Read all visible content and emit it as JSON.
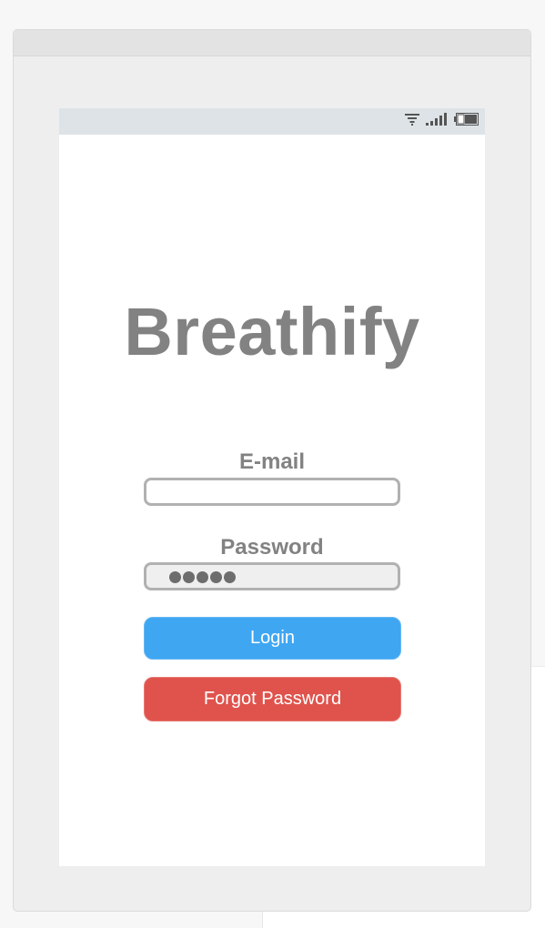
{
  "app": {
    "title": "Breathify"
  },
  "form": {
    "email_label": "E-mail",
    "email_value": "",
    "password_label": "Password",
    "password_length": 5
  },
  "buttons": {
    "login_label": "Login",
    "forgot_label": "Forgot Password"
  },
  "status_bar": {
    "icons": [
      "wifi-icon",
      "signal-icon",
      "battery-icon"
    ]
  },
  "colors": {
    "login": "#3fa6f2",
    "forgot": "#df534c",
    "text_gray": "#828282",
    "status_bar": "#dde3e6"
  }
}
